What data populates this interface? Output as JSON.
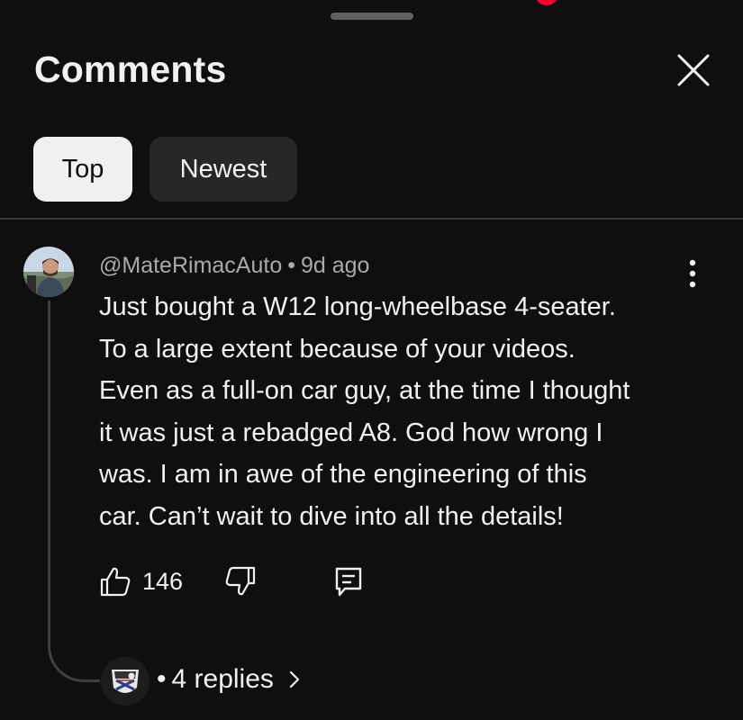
{
  "panel": {
    "title": "Comments",
    "close_icon": "close-icon"
  },
  "sort_chips": [
    {
      "label": "Top",
      "selected": true
    },
    {
      "label": "Newest",
      "selected": false
    }
  ],
  "comment": {
    "author": "@MateRimacAuto",
    "separator": "•",
    "time": "9d ago",
    "lines": [
      "Just bought a W12 long-wheelbase 4-seater.",
      "To a large extent because of your videos.",
      "Even as a full-on car guy, at the time I thought",
      "it was just a rebadged A8. God how wrong I",
      "was. I am in awe of the engineering of this",
      "car. Can’t wait to dive into all the details!"
    ],
    "likes": "146",
    "menu_icon": "more-vert-icon"
  },
  "replies": {
    "dot": "•",
    "label": "4 replies"
  },
  "colors": {
    "background": "#0f0f0f",
    "chip_active": "#f1f1f1",
    "chip_inactive": "#272727",
    "notification": "#ff0033",
    "muted_text": "#aaaaaa"
  }
}
